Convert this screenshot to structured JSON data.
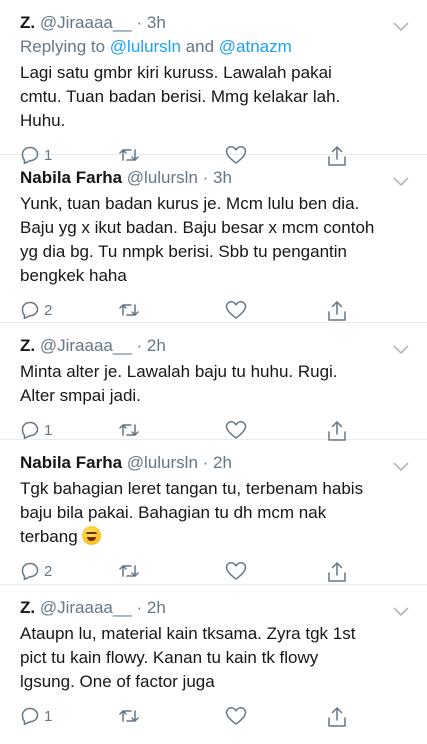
{
  "tweets": [
    {
      "name": "Z.",
      "handle": "@Jiraaaa__",
      "dot": "·",
      "time": "3h",
      "replying_prefix": "Replying to",
      "mention_1": "@lulursln",
      "conj": "and",
      "mention_2": "@atnazm",
      "text": "Lagi satu gmbr kiri kuruss. Lawalah pakai cmtu. Tuan badan berisi. Mmg kelakar lah. Huhu.",
      "reply_count": "1"
    },
    {
      "name": "Nabila Farha",
      "handle": "@lulursln",
      "dot": "·",
      "time": "3h",
      "text": "Yunk, tuan badan kurus je. Mcm lulu ben dia. Baju yg x ikut badan. Baju besar x mcm contoh yg dia bg. Tu nmpk berisi. Sbb tu pengantin bengkek haha",
      "reply_count": "2"
    },
    {
      "name": "Z.",
      "handle": "@Jiraaaa__",
      "dot": "·",
      "time": "2h",
      "text": "Minta alter je. Lawalah baju tu huhu. Rugi. Alter smpai jadi.",
      "reply_count": "1"
    },
    {
      "name": "Nabila Farha",
      "handle": "@lulursln",
      "dot": "·",
      "time": "2h",
      "text": "Tgk bahagian leret tangan tu, terbenam habis baju bila pakai. Bahagian tu dh mcm nak terbang",
      "emoji": "laughing-emoji",
      "reply_count": "2"
    },
    {
      "name": "Z.",
      "handle": "@Jiraaaa__",
      "dot": "·",
      "time": "2h",
      "text": "Ataupn lu, material kain tksama. Zyra tgk 1st pict tu kain flowy. Kanan tu kain tk flowy lgsung. One of factor juga",
      "reply_count": "1"
    }
  ],
  "icons": {
    "reply": "reply-icon",
    "retweet": "retweet-icon",
    "like": "heart-icon",
    "share": "share-icon",
    "menu": "chevron-down-icon"
  },
  "colors": {
    "link": "#1da1f2",
    "secondary": "#657786",
    "text": "#14171a"
  }
}
